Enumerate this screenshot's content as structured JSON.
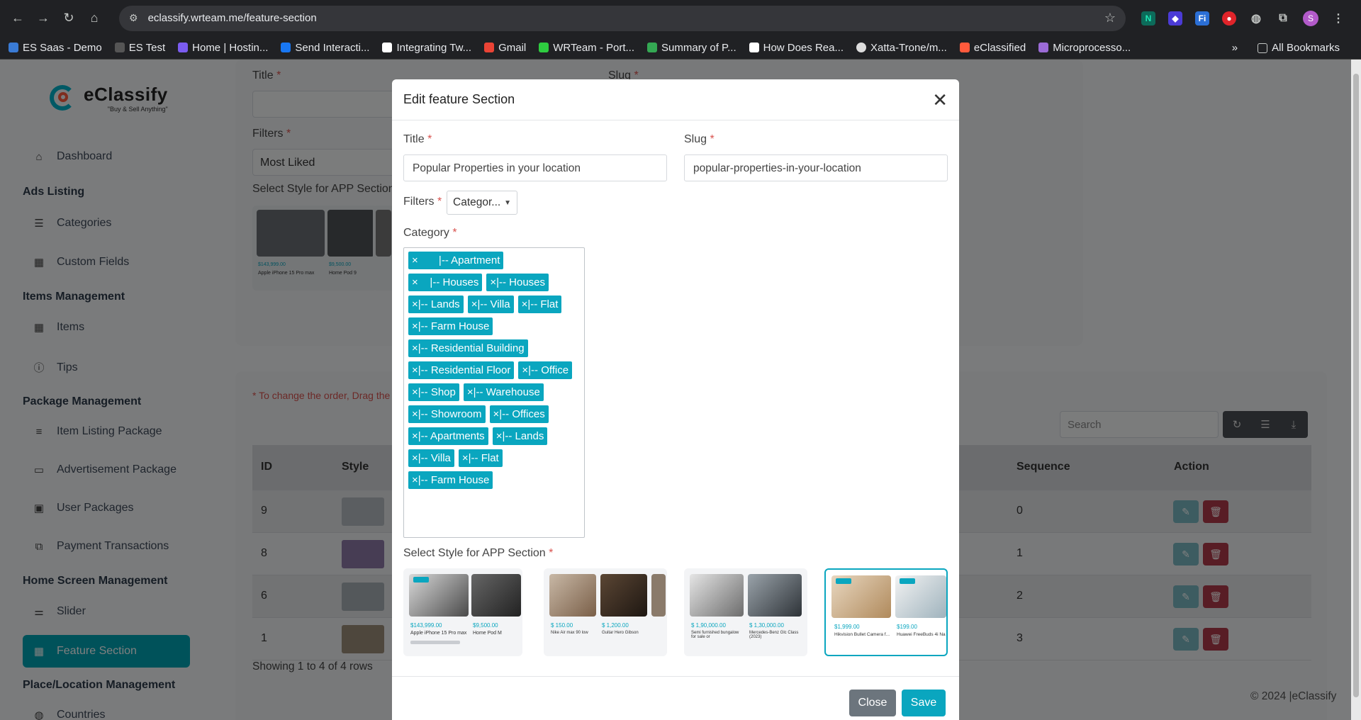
{
  "browser": {
    "url": "eclassify.wrteam.me/feature-section",
    "bookmarks": [
      "ES Saas - Demo",
      "ES Test",
      "Home | Hostin...",
      "Send Interacti...",
      "Integrating Tw...",
      "Gmail",
      "WRTeam - Port...",
      "Summary of P...",
      "How Does Rea...",
      "Xatta-Trone/m...",
      "eClassified",
      "Microprocesso..."
    ],
    "all_bookmarks": "All Bookmarks",
    "more": "»",
    "profile_initial": "S"
  },
  "sidebar": {
    "logo_name": "eClassify",
    "logo_tag": "\"Buy & Sell Anything\"",
    "dashboard": "Dashboard",
    "sections": {
      "ads": "Ads Listing",
      "items": "Items Management",
      "package": "Package Management",
      "home": "Home Screen Management",
      "place": "Place/Location Management"
    },
    "items": {
      "categories": "Categories",
      "custom_fields": "Custom Fields",
      "items": "Items",
      "tips": "Tips",
      "item_listing_package": "Item Listing Package",
      "advertisement_package": "Advertisement Package",
      "user_packages": "User Packages",
      "payment_transactions": "Payment Transactions",
      "slider": "Slider",
      "feature_section": "Feature Section",
      "countries": "Countries"
    }
  },
  "background": {
    "title_label": "Title",
    "slug_label": "Slug",
    "filters_label": "Filters",
    "filters_value": "Most Liked",
    "style_label": "Select Style for APP Section",
    "thumb_price_1": "$143,999.00",
    "thumb_name_1": "Apple iPhone 15 Pro max",
    "thumb_price_2": "$9,500.00",
    "thumb_name_2": "Home Pod 9",
    "order_note": "* To change the order, Drag the",
    "search_placeholder": "Search",
    "table": {
      "headers": {
        "id": "ID",
        "style": "Style",
        "sequence": "Sequence",
        "action": "Action"
      },
      "rows": [
        {
          "id": "9",
          "sequence": "0"
        },
        {
          "id": "8",
          "sequence": "1"
        },
        {
          "id": "6",
          "sequence": "2"
        },
        {
          "id": "1",
          "sequence": "3"
        }
      ]
    },
    "showing": "Showing 1 to 4 of 4 rows",
    "copyright": "© 2024 |eClassify"
  },
  "modal": {
    "title": "Edit feature Section",
    "title_label": "Title",
    "title_value": "Popular Properties in your location",
    "slug_label": "Slug",
    "slug_value": "popular-properties-in-your-location",
    "filters_label": "Filters",
    "filters_value": "Categor...",
    "category_label": "Category",
    "categories": [
      "×       |-- Apartment",
      "×    |-- Houses",
      "×|-- Houses",
      "×|-- Lands",
      "×|-- Villa",
      "×|-- Flat",
      "×|-- Farm House",
      "×|-- Residential Building",
      "×|-- Residential Floor",
      "×|-- Office",
      "×|-- Shop",
      "×|-- Warehouse",
      "×|-- Showroom",
      "×|-- Offices",
      "×|-- Apartments",
      "×|-- Lands",
      "×|-- Villa",
      "×|-- Flat",
      "×|-- Farm House"
    ],
    "style_label": "Select Style for APP Section",
    "styles": [
      {
        "price_a": "$143,999.00",
        "name_a": "Apple iPhone 15 Pro max",
        "price_b": "$9,500.00",
        "name_b": "Home Pod M"
      },
      {
        "price_a": "$ 150.00",
        "name_a": "Nike Air max 90 low",
        "price_b": "$ 1,200.00",
        "name_b": "Guitar Hero Gibson"
      },
      {
        "price_a": "$ 1,90,000.00",
        "name_a": "Semi furnished bungalow for sale or",
        "price_b": "$ 1,30,000.00",
        "name_b": "Mercedes-Benz Glc Class (2023)"
      },
      {
        "price_a": "$1,999.00",
        "name_a": "Hikvision Bullet Camera f...",
        "price_b": "$199.00",
        "name_b": "Huawei FreeBuds 4i Na"
      }
    ],
    "selected_style": 3,
    "close_label": "Close",
    "save_label": "Save"
  }
}
